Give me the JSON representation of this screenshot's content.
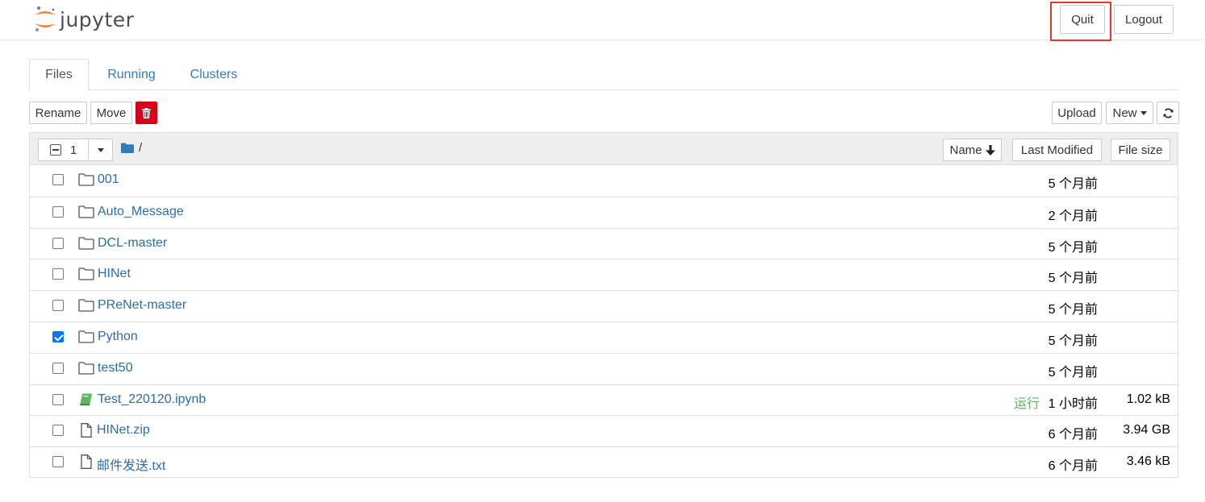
{
  "app": {
    "name": "jupyter"
  },
  "header": {
    "quit_label": "Quit",
    "logout_label": "Logout",
    "highlight_color": "#e8362d"
  },
  "tabs": [
    {
      "label": "Files",
      "active": true
    },
    {
      "label": "Running",
      "active": false
    },
    {
      "label": "Clusters",
      "active": false
    }
  ],
  "toolbar": {
    "rename_label": "Rename",
    "move_label": "Move",
    "delete_icon": "trash-icon",
    "upload_label": "Upload",
    "new_label": "New",
    "refresh_icon": "refresh-icon"
  },
  "list_header": {
    "selected_count": "1",
    "path": "/",
    "sort_name_label": "Name",
    "sort_modified_label": "Last Modified",
    "sort_size_label": "File size"
  },
  "files": [
    {
      "name": "001",
      "type": "folder",
      "checked": false,
      "status": "",
      "modified": "5 个月前",
      "size": ""
    },
    {
      "name": "Auto_Message",
      "type": "folder",
      "checked": false,
      "status": "",
      "modified": "2 个月前",
      "size": ""
    },
    {
      "name": "DCL-master",
      "type": "folder",
      "checked": false,
      "status": "",
      "modified": "5 个月前",
      "size": ""
    },
    {
      "name": "HINet",
      "type": "folder",
      "checked": false,
      "status": "",
      "modified": "5 个月前",
      "size": ""
    },
    {
      "name": "PReNet-master",
      "type": "folder",
      "checked": false,
      "status": "",
      "modified": "5 个月前",
      "size": ""
    },
    {
      "name": "Python",
      "type": "folder",
      "checked": true,
      "status": "",
      "modified": "5 个月前",
      "size": ""
    },
    {
      "name": "test50",
      "type": "folder",
      "checked": false,
      "status": "",
      "modified": "5 个月前",
      "size": ""
    },
    {
      "name": "Test_220120.ipynb",
      "type": "notebook",
      "checked": false,
      "status": "运行",
      "modified": "1 小时前",
      "size": "1.02 kB"
    },
    {
      "name": "HINet.zip",
      "type": "file",
      "checked": false,
      "status": "",
      "modified": "6 个月前",
      "size": "3.94 GB"
    },
    {
      "name": "邮件发送.txt",
      "type": "file",
      "checked": false,
      "status": "",
      "modified": "6 个月前",
      "size": "3.46 kB"
    }
  ],
  "colors": {
    "link": "#2e6da4",
    "running": "#5cb85c",
    "delete": "#d9001b",
    "logo_orange": "#f37726"
  }
}
